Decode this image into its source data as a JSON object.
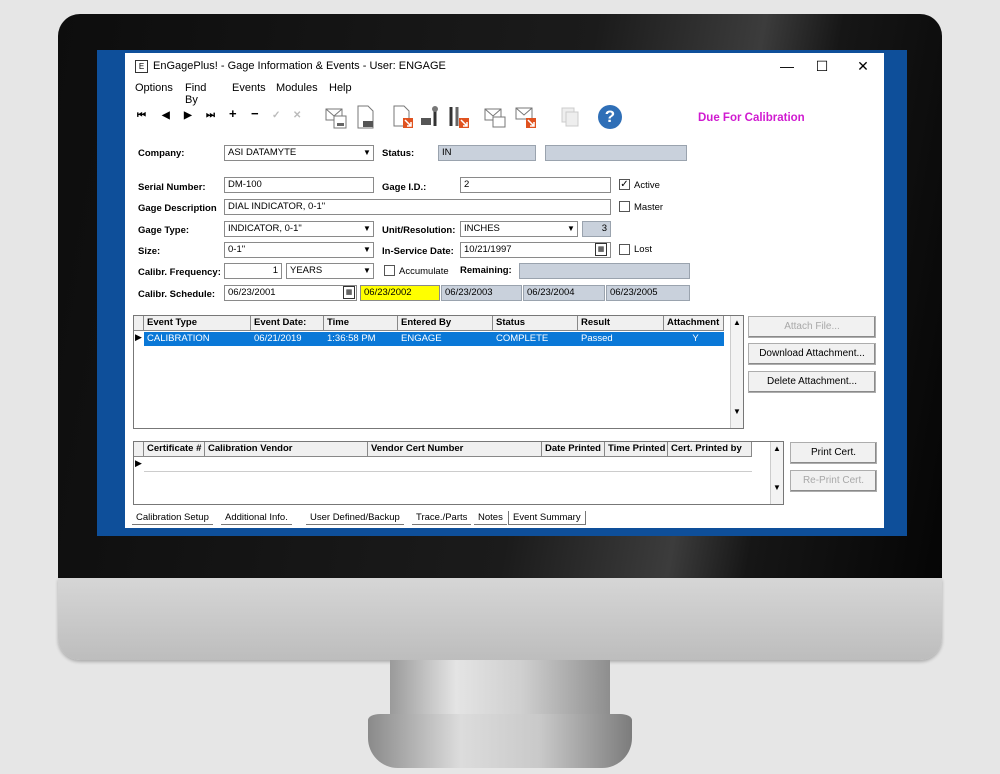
{
  "window": {
    "title": "EnGagePlus! -  Gage Information & Events - User: ENGAGE",
    "icon_text": "E"
  },
  "menu": [
    "Options",
    "Find By",
    "Events",
    "Modules",
    "Help"
  ],
  "toolbar": {
    "nav_first": "⏮",
    "nav_prev": "◀",
    "nav_next": "▶",
    "nav_last": "⏭",
    "add": "+",
    "remove": "−",
    "confirm": "✓",
    "cancel": "✕",
    "help": "?",
    "due_status": "Due For Calibration"
  },
  "form": {
    "company_label": "Company:",
    "company": "ASI DATAMYTE",
    "status_label": "Status:",
    "status": "IN",
    "serial_label": "Serial Number:",
    "serial": "DM-100",
    "gage_id_label": "Gage I.D.:",
    "gage_id": "2",
    "active_label": "Active",
    "active_checked": true,
    "desc_label": "Gage Description",
    "desc": "DIAL INDICATOR, 0-1\"",
    "master_label": "Master",
    "type_label": "Gage Type:",
    "type": "INDICATOR, 0-1\"",
    "unit_label": "Unit/Resolution:",
    "unit": "INCHES",
    "resolution": "3",
    "size_label": "Size:",
    "size": "0-1\"",
    "inservice_label": "In-Service Date:",
    "inservice": "10/21/1997",
    "lost_label": "Lost",
    "freq_label": "Calibr. Frequency:",
    "freq": "1",
    "freq_unit": "YEARS",
    "accumulate_label": "Accumulate",
    "remaining_label": "Remaining:",
    "sched_label": "Calibr. Schedule:",
    "sched_date": "06/23/2001",
    "sched": [
      "06/23/2002",
      "06/23/2003",
      "06/23/2004",
      "06/23/2005"
    ]
  },
  "events": {
    "columns": [
      "Event Type",
      "Event Date:",
      "Time",
      "Entered By",
      "Status",
      "Result",
      "Attachment"
    ],
    "rows": [
      [
        "CALIBRATION",
        "06/21/2019",
        "1:36:58 PM",
        "ENGAGE",
        "COMPLETE",
        "Passed",
        "Y"
      ]
    ]
  },
  "event_buttons": {
    "attach": "Attach File...",
    "download": "Download Attachment...",
    "delete": "Delete Attachment..."
  },
  "certs": {
    "columns": [
      "Certificate #",
      "Calibration Vendor",
      "Vendor Cert Number",
      "Date Printed",
      "Time Printed",
      "Cert. Printed by"
    ]
  },
  "cert_buttons": {
    "print": "Print Cert.",
    "reprint": "Re-Print Cert."
  },
  "tabs": [
    "Calibration Setup",
    "Additional Info.",
    "User Defined/Backup",
    "Trace./Parts",
    "Notes",
    "Event Summary"
  ]
}
